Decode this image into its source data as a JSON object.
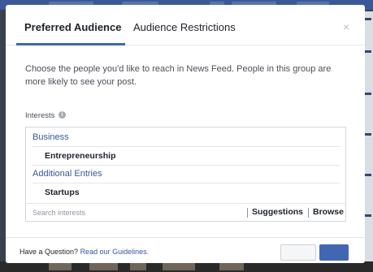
{
  "tabs": [
    {
      "label": "Preferred Audience",
      "active": true
    },
    {
      "label": "Audience Restrictions",
      "active": false
    }
  ],
  "close_glyph": "×",
  "description": "Choose the people you'd like to reach in News Feed. People in this group are more likely to see your post.",
  "interests": {
    "label": "Interests",
    "info_glyph": "i",
    "groups": [
      {
        "category": "Business",
        "item": "Entrepreneurship"
      },
      {
        "category": "Additional Entries",
        "item": "Startups"
      }
    ],
    "search_placeholder": "Search interests",
    "suggestions_label": "Suggestions",
    "browse_label": "Browse"
  },
  "footer": {
    "question": "Have a Question?",
    "guidelines_link": "Read our Guidelines."
  },
  "colors": {
    "accent": "#4267b2",
    "link": "#365899"
  }
}
